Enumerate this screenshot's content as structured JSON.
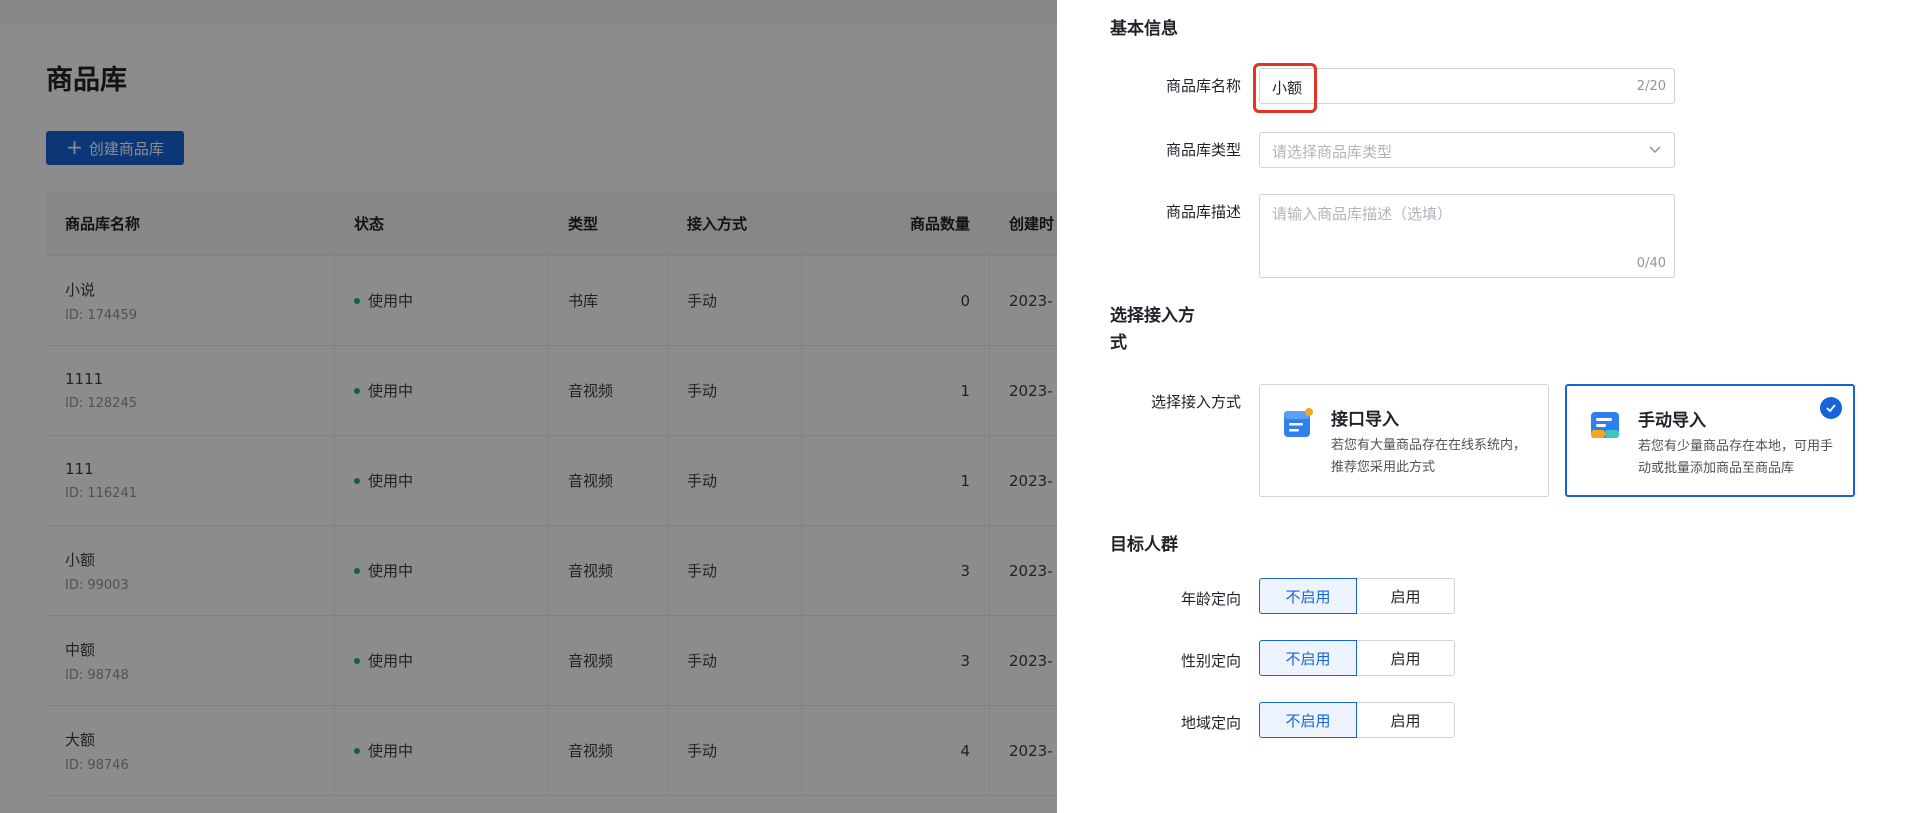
{
  "background": {
    "page_title": "商品库",
    "create_button": "创建商品库",
    "table": {
      "headers": [
        "商品库名称",
        "状态",
        "类型",
        "接入方式",
        "商品数量",
        "创建时"
      ],
      "rows": [
        {
          "name": "小说",
          "id": "ID: 174459",
          "status": "使用中",
          "type": "书库",
          "method": "手动",
          "count": "0",
          "created": "2023-"
        },
        {
          "name": "1111",
          "id": "ID: 128245",
          "status": "使用中",
          "type": "音视频",
          "method": "手动",
          "count": "1",
          "created": "2023-"
        },
        {
          "name": "111",
          "id": "ID: 116241",
          "status": "使用中",
          "type": "音视频",
          "method": "手动",
          "count": "1",
          "created": "2023-"
        },
        {
          "name": "小额",
          "id": "ID: 99003",
          "status": "使用中",
          "type": "音视频",
          "method": "手动",
          "count": "3",
          "created": "2023-"
        },
        {
          "name": "中额",
          "id": "ID: 98748",
          "status": "使用中",
          "type": "音视频",
          "method": "手动",
          "count": "3",
          "created": "2023-"
        },
        {
          "name": "大额",
          "id": "ID: 98746",
          "status": "使用中",
          "type": "音视频",
          "method": "手动",
          "count": "4",
          "created": "2023-"
        }
      ]
    }
  },
  "drawer": {
    "basic_info": {
      "title": "基本信息",
      "name_label": "商品库名称",
      "name_value": "小额",
      "name_counter": "2/20",
      "type_label": "商品库类型",
      "type_placeholder": "请选择商品库类型",
      "desc_label": "商品库描述",
      "desc_placeholder": "请输入商品库描述（选填）",
      "desc_counter": "0/40"
    },
    "access": {
      "title_line1": "选择接入方",
      "title_line2": "式",
      "label": "选择接入方式",
      "options": [
        {
          "title": "接口导入",
          "desc": "若您有大量商品存在在线系统内，推荐您采用此方式",
          "selected": false
        },
        {
          "title": "手动导入",
          "desc": "若您有少量商品存在本地，可用手动或批量添加商品至商品库",
          "selected": true
        }
      ]
    },
    "audience": {
      "title": "目标人群",
      "rows": [
        {
          "label": "年龄定向",
          "off": "不启用",
          "on": "启用",
          "selected": "off"
        },
        {
          "label": "性别定向",
          "off": "不启用",
          "on": "启用",
          "selected": "off"
        },
        {
          "label": "地域定向",
          "off": "不启用",
          "on": "启用",
          "selected": "off"
        }
      ]
    }
  },
  "colors": {
    "primary": "#1664d9",
    "highlight": "#e23324",
    "status_active": "#1fb26b"
  }
}
